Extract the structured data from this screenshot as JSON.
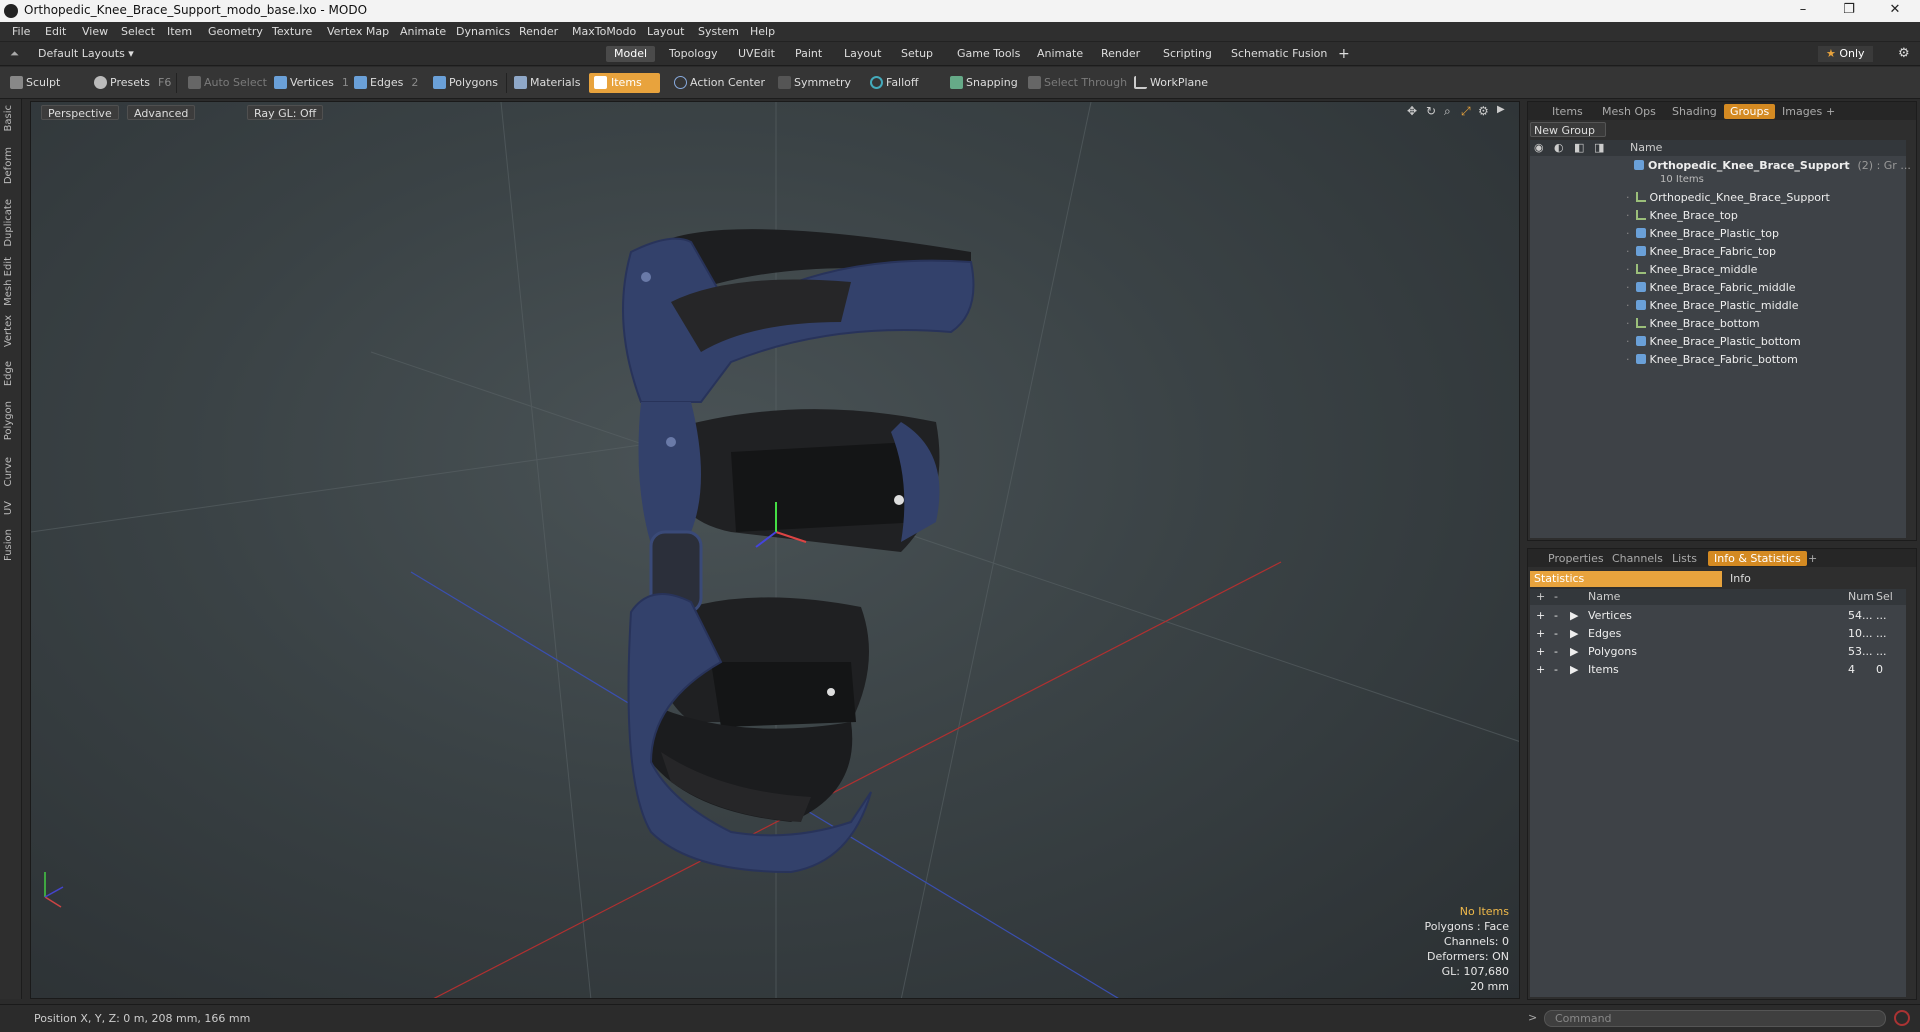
{
  "window": {
    "title": "Orthopedic_Knee_Brace_Support_modo_base.lxo - MODO",
    "controls": [
      "–",
      "❐",
      "✕"
    ]
  },
  "menu": [
    "File",
    "Edit",
    "View",
    "Select",
    "Item",
    "Geometry",
    "Texture",
    "Vertex Map",
    "Animate",
    "Dynamics",
    "Render",
    "MaxToModo",
    "Layout",
    "System",
    "Help"
  ],
  "layout_selector": "Default Layouts ▾",
  "layout_tabs": [
    "Model",
    "Topology",
    "UVEdit",
    "Paint",
    "Layout",
    "Setup",
    "Game Tools",
    "Animate",
    "Render",
    "Scripting",
    "Schematic Fusion"
  ],
  "only_label": "Only",
  "toolbar": {
    "sculpt": "Sculpt",
    "presets": "Presets",
    "presets_key": "F6",
    "auto_select": "Auto Select",
    "vertices": "Vertices",
    "vertices_key": "1",
    "edges": "Edges",
    "edges_key": "2",
    "polygons": "Polygons",
    "materials": "Materials",
    "items": "Items",
    "action_center": "Action Center",
    "symmetry": "Symmetry",
    "falloff": "Falloff",
    "snapping": "Snapping",
    "select_through": "Select Through",
    "workplane": "WorkPlane"
  },
  "left_tabs": [
    "Basic",
    "Deform",
    "Duplicate",
    "Mesh Edit",
    "Vertex",
    "Edge",
    "Polygon",
    "Curve",
    "UV",
    "Fusion"
  ],
  "viewport": {
    "view": "Perspective",
    "shading": "Advanced",
    "raygl": "Ray GL: Off",
    "info": {
      "no_items": "No Items",
      "polygons": "Polygons : Face",
      "channels": "Channels: 0",
      "deformers": "Deformers: ON",
      "gl": "GL: 107,680",
      "scale": "20 mm"
    }
  },
  "status": {
    "position": "Position X, Y, Z:  0 m, 208 mm, 166 mm",
    "command_placeholder": "Command"
  },
  "top_panel": {
    "tabs": [
      "Items",
      "Mesh Ops",
      "Shading",
      "Groups",
      "Images"
    ],
    "active_tab": "Groups",
    "new_group": "New Group",
    "name_header": "Name",
    "group_name": "Orthopedic_Knee_Brace_Support",
    "group_suffix": "(2) : Gr ...",
    "group_count": "10 Items",
    "items": [
      {
        "name": "Orthopedic_Knee_Brace_Support",
        "icon": "locator-icon"
      },
      {
        "name": "Knee_Brace_top",
        "icon": "locator-icon"
      },
      {
        "name": "Knee_Brace_Plastic_top",
        "icon": "mesh-icon"
      },
      {
        "name": "Knee_Brace_Fabric_top",
        "icon": "mesh-icon"
      },
      {
        "name": "Knee_Brace_middle",
        "icon": "locator-icon"
      },
      {
        "name": "Knee_Brace_Fabric_middle",
        "icon": "mesh-icon"
      },
      {
        "name": "Knee_Brace_Plastic_middle",
        "icon": "mesh-icon"
      },
      {
        "name": "Knee_Brace_bottom",
        "icon": "locator-icon"
      },
      {
        "name": "Knee_Brace_Plastic_bottom",
        "icon": "mesh-icon"
      },
      {
        "name": "Knee_Brace_Fabric_bottom",
        "icon": "mesh-icon"
      }
    ]
  },
  "bottom_panel": {
    "tabs": [
      "Properties",
      "Channels",
      "Lists",
      "Info & Statistics"
    ],
    "active_tab": "Info & Statistics",
    "subtabs": [
      "Statistics",
      "Info"
    ],
    "headers": {
      "name": "Name",
      "num": "Num",
      "sel": "Sel"
    },
    "rows": [
      {
        "name": "Vertices",
        "num": "54...",
        "sel": "..."
      },
      {
        "name": "Edges",
        "num": "10...",
        "sel": "..."
      },
      {
        "name": "Polygons",
        "num": "53...",
        "sel": "..."
      },
      {
        "name": "Items",
        "num": "4",
        "sel": "0"
      }
    ]
  },
  "colors": {
    "accent": "#e8a33d",
    "brace_blue": "#33416b",
    "fabric": "#1e1f21"
  }
}
